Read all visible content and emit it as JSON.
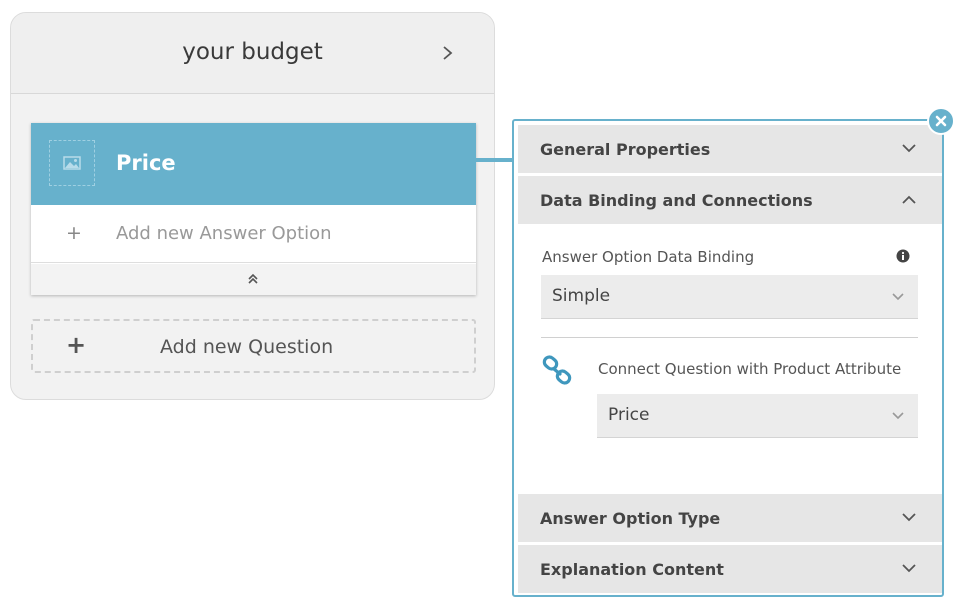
{
  "question_card": {
    "title": "your budget",
    "question": {
      "title": "Price",
      "add_answer_label": "Add new Answer Option",
      "add_answer_symbol": "+"
    },
    "add_question_label": "Add new Question",
    "add_question_symbol": "+"
  },
  "properties": {
    "sections": {
      "general": "General Properties",
      "data_binding": "Data Binding and Connections",
      "answer_type": "Answer Option Type",
      "explanation": "Explanation Content"
    },
    "answer_binding_label": "Answer Option Data Binding",
    "answer_binding_value": "Simple",
    "connect_label": "Connect Question with Product Attribute",
    "connect_value": "Price"
  },
  "icons": {
    "close": "close-icon",
    "link": "link-icon",
    "info": "info-icon",
    "image": "image-icon"
  },
  "colors": {
    "accent": "#67b1cc",
    "section_bg": "#e6e6e6",
    "select_bg": "#ececec"
  }
}
